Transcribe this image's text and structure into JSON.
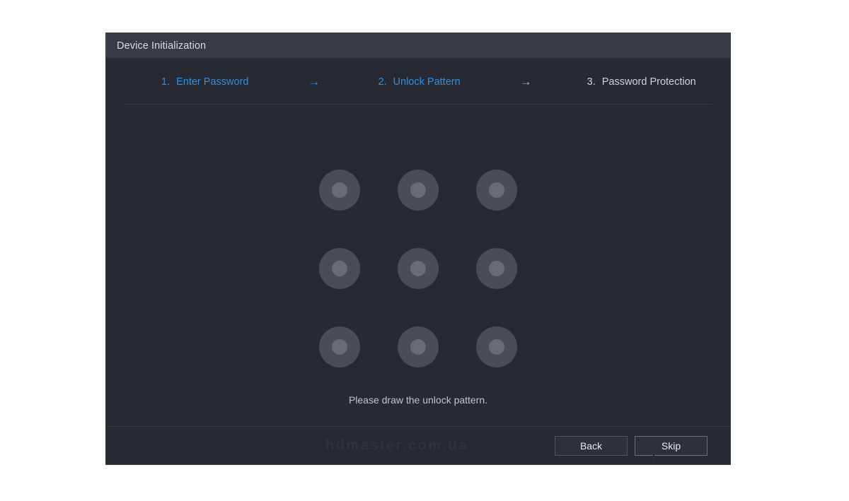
{
  "window": {
    "title": "Device Initialization"
  },
  "steps": {
    "items": [
      {
        "number": "1.",
        "label": "Enter Password",
        "state": "active"
      },
      {
        "number": "2.",
        "label": "Unlock Pattern",
        "state": "active"
      },
      {
        "number": "3.",
        "label": "Password Protection",
        "state": "inactive"
      }
    ],
    "arrows": [
      {
        "glyph": "→",
        "state": "active"
      },
      {
        "glyph": "→",
        "state": "inactive"
      }
    ]
  },
  "pattern": {
    "rows": 3,
    "columns": 3,
    "dots": [
      {
        "id": "dot-1"
      },
      {
        "id": "dot-2"
      },
      {
        "id": "dot-3"
      },
      {
        "id": "dot-4"
      },
      {
        "id": "dot-5"
      },
      {
        "id": "dot-6"
      },
      {
        "id": "dot-7"
      },
      {
        "id": "dot-8"
      },
      {
        "id": "dot-9"
      }
    ],
    "hint": "Please draw the unlock pattern."
  },
  "footer": {
    "watermark": "hdmaster.com.ua",
    "buttons": [
      {
        "label": "Back",
        "focused": false
      },
      {
        "label": "Skip",
        "focused": true
      }
    ]
  },
  "colors": {
    "page_background": "#ffffff",
    "dialog_background": "#282a33",
    "titlebar_background": "#383b45",
    "accent_blue": "#2f8fe0",
    "text_primary": "#d8dade",
    "dot_outer": "#4a4d57",
    "dot_inner": "#696c75",
    "divider": "#373a44",
    "button_border": "#50535d"
  }
}
